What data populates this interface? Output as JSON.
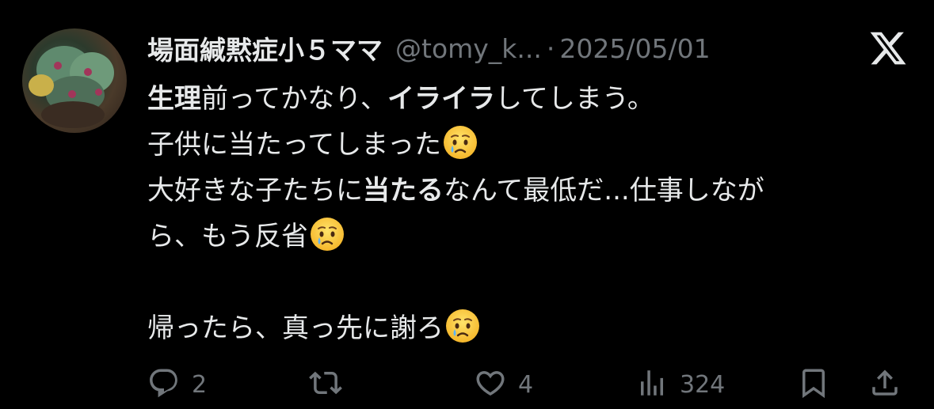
{
  "tweet": {
    "author_name": "場面緘黙症小５ママ",
    "handle": "@tomy_k...",
    "separator": "·",
    "date": "2025/05/01",
    "lines": [
      [
        {
          "t": "生理",
          "b": true
        },
        {
          "t": "前ってかなり、"
        },
        {
          "t": "イライラ",
          "b": true
        },
        {
          "t": "してしまう。"
        }
      ],
      [
        {
          "t": "子供に当たってしまった"
        },
        {
          "emoji": "crying-face"
        }
      ],
      [
        {
          "t": "大好きな子たちに"
        },
        {
          "t": "当たる",
          "b": true
        },
        {
          "t": "なんて最低だ...仕事しなが"
        }
      ],
      [
        {
          "t": "ら、もう反省"
        },
        {
          "emoji": "crying-face"
        }
      ],
      [],
      [
        {
          "t": "帰ったら、真っ先に謝ろ"
        },
        {
          "emoji": "crying-face"
        }
      ]
    ]
  },
  "actions": {
    "reply_count": "2",
    "like_count": "4",
    "view_count": "324"
  },
  "icons": [
    "avatar",
    "x-logo-icon",
    "reply-icon",
    "retweet-icon",
    "like-icon",
    "views-icon",
    "bookmark-icon",
    "share-icon",
    "crying-face-emoji"
  ],
  "colors": {
    "background": "#000000",
    "text": "#e7e9ea",
    "muted": "#71767b"
  }
}
